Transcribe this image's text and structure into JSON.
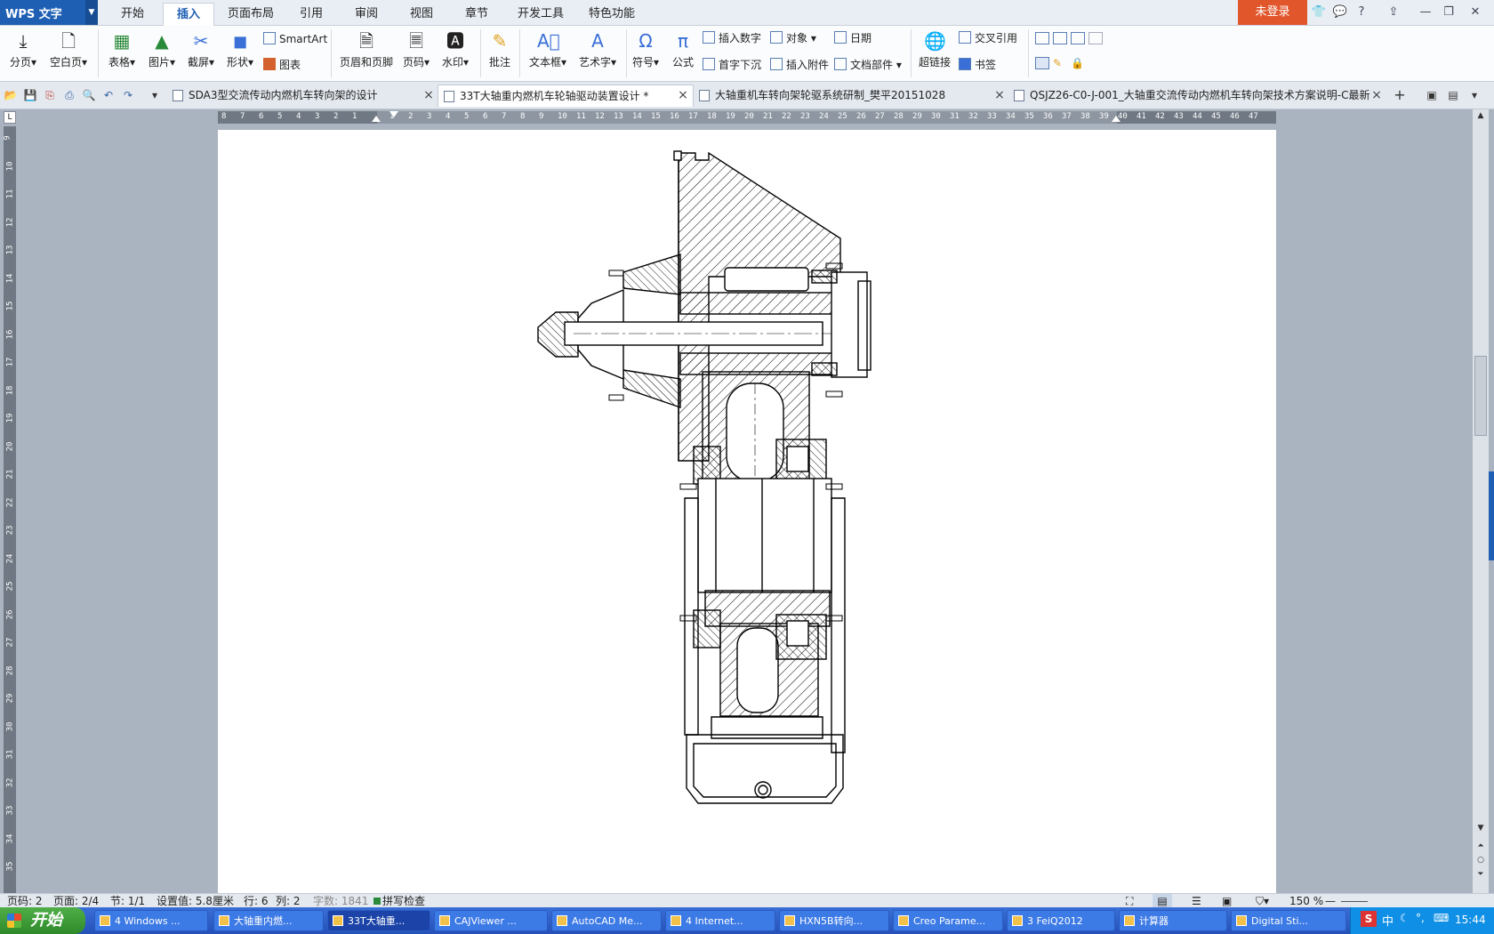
{
  "app": {
    "name": "WPS 文字",
    "login": "未登录"
  },
  "menu": [
    "开始",
    "插入",
    "页面布局",
    "引用",
    "审阅",
    "视图",
    "章节",
    "开发工具",
    "特色功能"
  ],
  "ribbon": {
    "fenye": "分页",
    "kongbaiye": "空白页",
    "biaoge": "表格",
    "tupian": "图片",
    "jietu": "截屏",
    "xingzhuang": "形状",
    "smartart": "SmartArt",
    "tubiao": "图表",
    "yemei": "页眉和页脚",
    "yema": "页码",
    "shuiyin": "水印",
    "pizhu": "批注",
    "wenbenkuang": "文本框",
    "yishuzi": "艺术字",
    "fuhao": "符号",
    "gongshi": "公式",
    "charu_shuzi": "插入数字",
    "duixiang": "对象",
    "riqi": "日期",
    "shouzi": "首字下沉",
    "charu_fujian": "插入附件",
    "wendang_bujian": "文档部件",
    "chaolianjie": "超链接",
    "jiaocha": "交叉引用",
    "shuqian": "书签"
  },
  "tabs": [
    {
      "title": "SDA3型交流传动内燃机车转向架的设计",
      "active": false
    },
    {
      "title": "33T大轴重内燃机车轮轴驱动装置设计 *",
      "active": true
    },
    {
      "title": "大轴重机车转向架轮驱系统研制_樊平20151028",
      "active": false
    },
    {
      "title": "QSJZ26-C0-J-001_大轴重交流传动内燃机车转向架技术方案说明-C最新",
      "active": false
    }
  ],
  "ruler_h": [
    "8",
    "7",
    "6",
    "5",
    "4",
    "3",
    "2",
    "1",
    "",
    "1",
    "2",
    "3",
    "4",
    "5",
    "6",
    "7",
    "8",
    "9",
    "10",
    "11",
    "12",
    "13",
    "14",
    "15",
    "16",
    "17",
    "18",
    "19",
    "20",
    "21",
    "22",
    "23",
    "24",
    "25",
    "26",
    "27",
    "28",
    "29",
    "30",
    "31",
    "32",
    "33",
    "34",
    "35",
    "36",
    "37",
    "38",
    "39",
    "40",
    "41",
    "42",
    "43",
    "44",
    "45",
    "46",
    "47"
  ],
  "ruler_v": [
    "9",
    "10",
    "11",
    "12",
    "13",
    "14",
    "15",
    "16",
    "17",
    "18",
    "19",
    "20",
    "21",
    "22",
    "23",
    "24",
    "25",
    "26",
    "27",
    "28",
    "29",
    "30",
    "31",
    "32",
    "33",
    "34",
    "35"
  ],
  "status": {
    "page": "页码: 2",
    "pages": "页面: 2/4",
    "section": "节: 1/1",
    "setting": "设置值: 5.8厘米",
    "row": "行: 6",
    "col": "列: 2",
    "words": "字数: 1841",
    "spell": "拼写检查",
    "zoom": "150 %"
  },
  "taskbar": {
    "start": "开始",
    "items": [
      {
        "label": "4 Windows ...",
        "active": false
      },
      {
        "label": "大轴重内燃...",
        "active": false
      },
      {
        "label": "33T大轴重...",
        "active": true
      },
      {
        "label": "CAJViewer ...",
        "active": false
      },
      {
        "label": "AutoCAD Me...",
        "active": false
      },
      {
        "label": "4 Internet...",
        "active": false
      },
      {
        "label": "HXN5B转向...",
        "active": false
      },
      {
        "label": "Creo Parame...",
        "active": false
      },
      {
        "label": "3 FeiQ2012",
        "active": false
      },
      {
        "label": "计算器",
        "active": false
      },
      {
        "label": "Digital Sti...",
        "active": false
      }
    ],
    "clock": "15:44",
    "ime": "中"
  }
}
